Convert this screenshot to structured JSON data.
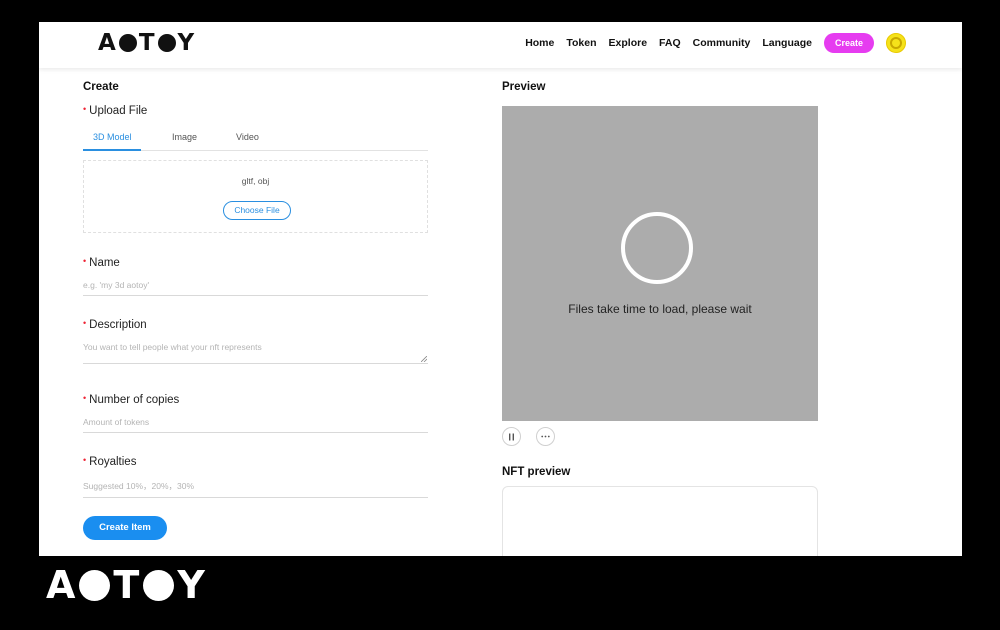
{
  "header": {
    "logo": {
      "left": "A",
      "mid": "T",
      "right": "Y"
    },
    "nav": [
      "Home",
      "Token",
      "Explore",
      "FAQ",
      "Community",
      "Language"
    ],
    "create_button": "Create"
  },
  "form": {
    "title": "Create",
    "upload_label": "Upload File",
    "tabs": [
      "3D Model",
      "Image",
      "Video"
    ],
    "active_tab": "3D Model",
    "formats": "gltf, obj",
    "choose_file": "Choose File",
    "name_label": "Name",
    "name_placeholder": "e.g. 'my 3d aotoy'",
    "description_label": "Description",
    "description_placeholder": "You want to tell people what your nft represents",
    "copies_label": "Number of copies",
    "copies_placeholder": "Amount of tokens",
    "royalties_label": "Royalties",
    "royalties_placeholder": "Suggested 10%，20%，30%",
    "submit": "Create Item"
  },
  "preview": {
    "title": "Preview",
    "loading_text": "Files take time to load, please wait",
    "pause_icon": "pause-icon",
    "more_icon": "more-icon",
    "nft_title": "NFT preview"
  },
  "brand": {
    "left": "A",
    "mid": "T",
    "right": "Y"
  },
  "colors": {
    "accent": "#1a8ef0",
    "create_pink": "#e63cf0",
    "preview_bg": "#acacac"
  }
}
